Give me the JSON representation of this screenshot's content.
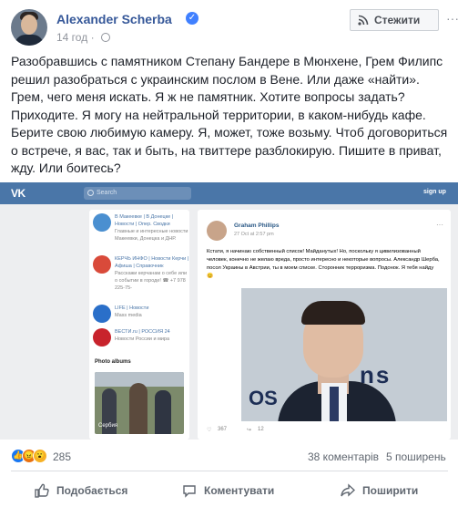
{
  "header": {
    "author": "Alexander Scherba",
    "time": "14 год",
    "follow_label": "Стежити",
    "more_label": "···"
  },
  "post": {
    "text": "Разобравшись с памятником Степану Бандере в Мюнхене, Грем Филипс решил разобраться с украинским послом в Вене. Или даже «найти». Грем, чего меня искать. Я ж не памятник. Хотите вопросы задать? Приходите. Я могу на нейтральной территории, в каком-нибудь кафе. Берите свою любимую камеру. Я, может, тоже возьму. Чтоб договориться о встрече, я вас, так и быть, на твиттере разблокирую. Пишите в приват, жду. Или боитесь?"
  },
  "screenshot": {
    "vk_logo": "VK",
    "search_placeholder": "Search",
    "signup": "sign up",
    "sidebar": [
      {
        "title": "В Макеевке | В Донецке | Новости | Опер. Сводки",
        "desc": "Главные и интересные новости Макеевки, Донецка и ДНР.",
        "color": "#4a8fd0"
      },
      {
        "title": "КЕРЧЬ ИНФО | Новости Керчи | Афиша | Справочник",
        "desc": "Расскажи керчанам о себе или о событии в городе! ☎ +7 978 225-75-",
        "color": "#d94a3a"
      },
      {
        "title": "LIFE | Новости",
        "desc": "Mass media",
        "color": "#2a6fc9"
      },
      {
        "title": "ВЕСТИ.ru | РОССИЯ 24",
        "desc": "Новости России и мира",
        "color": "#c8232c"
      }
    ],
    "photo_albums": "Photo albums",
    "album_caption": "Сербия",
    "vk_post": {
      "author": "Graham Phillips",
      "date": "27 Oct at 2:57 pm",
      "text": "Кстати, я начинаю собственный список! Майданутых! Но, поскольку я цивилизованный человек, конечно не желаю вреда, просто интересно и некоторые вопросы. Александр Шерба, посол Украины в Австрии, ты в моем списке. Сторонник терроризма. Подонок. Я тебя найду 😊",
      "photo_sign": "ns",
      "photo_sign2": "OS",
      "likes": "367",
      "shares": "12"
    }
  },
  "stats": {
    "reactions_count": "285",
    "comments": "38 коментарів",
    "shares": "5 поширень"
  },
  "actions": {
    "like": "Подобається",
    "comment": "Коментувати",
    "share": "Поширити"
  },
  "colors": {
    "link": "#365899",
    "vk_blue": "#4a76a8",
    "like_blue": "#1877f2"
  }
}
